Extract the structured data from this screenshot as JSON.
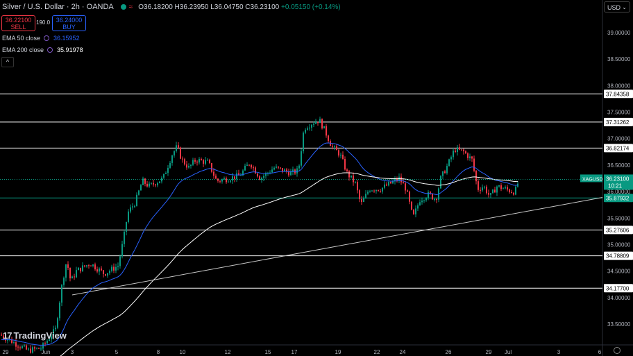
{
  "header": {
    "symbol": "Silver / U.S. Dollar · 2h · OANDA",
    "ohlc": "O36.18200 H36.23950 L36.04750 C36.23100",
    "change": "+0.05150 (+0.14%)"
  },
  "trade": {
    "sell_price": "36.22100",
    "sell_label": "SELL",
    "spread": "190.0",
    "buy_price": "36.24000",
    "buy_label": "BUY"
  },
  "indicators": [
    {
      "name": "EMA 50 close",
      "value": "36.15952",
      "color": "#2962ff"
    },
    {
      "name": "EMA 200 close",
      "value": "35.91978",
      "color": "#ffffff"
    }
  ],
  "currency_selector": "USD",
  "logo_text": "TradingView",
  "chart_data": {
    "type": "candlestick",
    "symbol": "XAGUSD",
    "timeframe": "2h",
    "ylim": [
      33.0,
      39.5
    ],
    "y_ticks": [
      "39.00000",
      "38.50000",
      "38.00000",
      "37.50000",
      "37.00000",
      "36.50000",
      "36.00000",
      "35.50000",
      "35.00000",
      "34.50000",
      "34.00000",
      "33.50000"
    ],
    "x_ticks": [
      "29",
      "Jun",
      "3",
      "5",
      "8",
      "10",
      "12",
      "15",
      "17",
      "19",
      "22",
      "24",
      "26",
      "29",
      "Jul",
      "3",
      "6"
    ],
    "horizontal_levels": [
      "37.84358",
      "37.31262",
      "36.82174",
      "35.87932",
      "35.27606",
      "34.78809",
      "34.17700"
    ],
    "last_price": {
      "symbol": "XAGUSD",
      "value": "36.23100",
      "countdown": "10:21"
    },
    "colors": {
      "up": "#089981",
      "down": "#f23645",
      "ema50": "#2962ff",
      "ema200": "#ffffff",
      "levels": "#ffffff",
      "highlight_level": "#089981"
    }
  }
}
